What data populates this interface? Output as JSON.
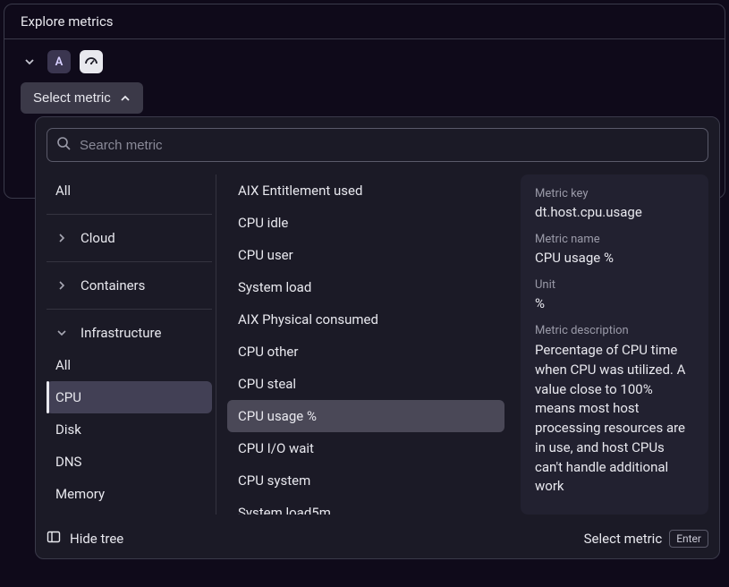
{
  "panel": {
    "title": "Explore metrics"
  },
  "query": {
    "badge": "A"
  },
  "selectButton": {
    "label": "Select metric"
  },
  "search": {
    "placeholder": "Search metric",
    "value": ""
  },
  "tree": {
    "topAll": "All",
    "groups": [
      {
        "label": "Cloud",
        "expanded": false
      },
      {
        "label": "Containers",
        "expanded": false
      },
      {
        "label": "Infrastructure",
        "expanded": true,
        "children": [
          {
            "label": "All",
            "active": false
          },
          {
            "label": "CPU",
            "active": true
          },
          {
            "label": "Disk",
            "active": false
          },
          {
            "label": "DNS",
            "active": false
          },
          {
            "label": "Memory",
            "active": false
          }
        ]
      }
    ]
  },
  "metrics": [
    "AIX Entitlement used",
    "CPU idle",
    "CPU user",
    "System load",
    "AIX Physical consumed",
    "CPU other",
    "CPU steal",
    "CPU usage %",
    "CPU I/O wait",
    "CPU system",
    "System load5m"
  ],
  "metricsActiveIndex": 7,
  "detail": {
    "keyLabel": "Metric key",
    "keyValue": "dt.host.cpu.usage",
    "nameLabel": "Metric name",
    "nameValue": "CPU usage %",
    "unitLabel": "Unit",
    "unitValue": "%",
    "descLabel": "Metric description",
    "descValue": "Percentage of CPU time when CPU was utilized. A value close to 100% means most host processing resources are in use, and host CPUs can't handle additional work"
  },
  "footer": {
    "hideTree": "Hide tree",
    "selectMetric": "Select metric",
    "enterKey": "Enter"
  }
}
